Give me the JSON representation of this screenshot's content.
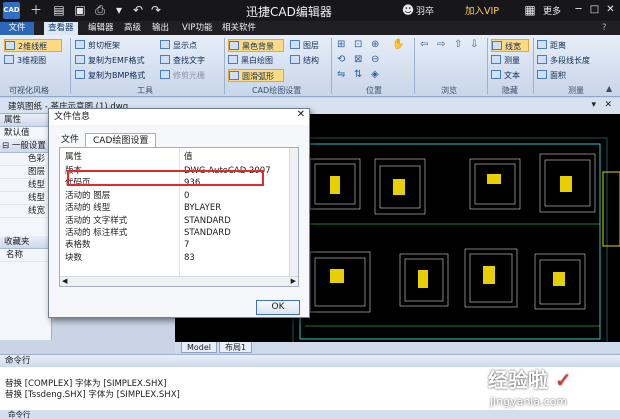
{
  "titlebar": {
    "logo_text": "CAD",
    "title": "迅捷CAD编辑器",
    "user": "羽卒",
    "vip": "加入VIP",
    "more": "更多"
  },
  "ribbon_tabs": [
    "文件",
    "查看器",
    "编辑器",
    "高级",
    "输出",
    "VIP功能",
    "相关软件"
  ],
  "ribbon": {
    "btn_2d": "2维线框",
    "btn_3d": "3维视图",
    "grp_visual": "可视化风格",
    "btn_clip": "剪切框架",
    "btn_copy_emf": "复制为EMF格式",
    "btn_copy_bmp": "复制为BMP格式",
    "grp_tools": "工具",
    "btn_showpoints": "显示点",
    "btn_findtext": "查找文字",
    "btn_raster": "修剪光栅",
    "btn_blackbg": "黑色背景",
    "btn_bw": "黑白绘图",
    "btn_arc": "圆滑弧形",
    "btn_layer": "图层",
    "btn_structure": "结构",
    "grp_cad_settings": "CAD绘图设置",
    "grp_position": "位置",
    "grp_browse": "浏览",
    "btn_linewidth": "线宽",
    "btn_measure": "测量",
    "btn_text": "文本",
    "grp_hide": "隐藏",
    "btn_distance": "距离",
    "btn_polyline_len": "多段线长度",
    "btn_area": "面积",
    "grp_measure": "测量"
  },
  "doc_tab": "建筑图纸 - 茶庄示意图 (1).dwg",
  "left_panel": {
    "header": "属性",
    "default": "默认值",
    "section": "一般设置",
    "rows": [
      "色彩",
      "图层",
      "线型",
      "线型",
      "线宽"
    ],
    "fav_header": "收藏夹",
    "fav_name": "名称"
  },
  "dialog": {
    "title": "文件信息",
    "tabs": [
      "文件",
      "CAD绘图设置"
    ],
    "col_property": "属性",
    "col_value": "值",
    "rows": [
      {
        "k": "版本",
        "v": "DWG AutoCAD 2007"
      },
      {
        "k": "代码页",
        "v": "936"
      },
      {
        "k": "活动的 图层",
        "v": "0"
      },
      {
        "k": "活动的 线型",
        "v": "BYLAYER"
      },
      {
        "k": "活动的 文字样式",
        "v": "STANDARD"
      },
      {
        "k": "活动的 标注样式",
        "v": "STANDARD"
      },
      {
        "k": "表格数",
        "v": "7"
      },
      {
        "k": "块数",
        "v": "83"
      }
    ],
    "ok": "OK"
  },
  "model_tabs": [
    "Model",
    "布局1"
  ],
  "command": {
    "header": "命令行",
    "lines": [
      "替换 [COMPLEX] 字体为 [SIMPLEX.SHX]",
      "替换 [Tssdeng.SHX] 字体为 [SIMPLEX.SHX]"
    ],
    "status_label": "命令行"
  },
  "watermark": {
    "main": "经验啦",
    "sub": "jingyanla.com"
  },
  "colors": {
    "highlight": "#e22a2a",
    "canvas": "#000000",
    "ribbon_active": "#fddb84"
  }
}
